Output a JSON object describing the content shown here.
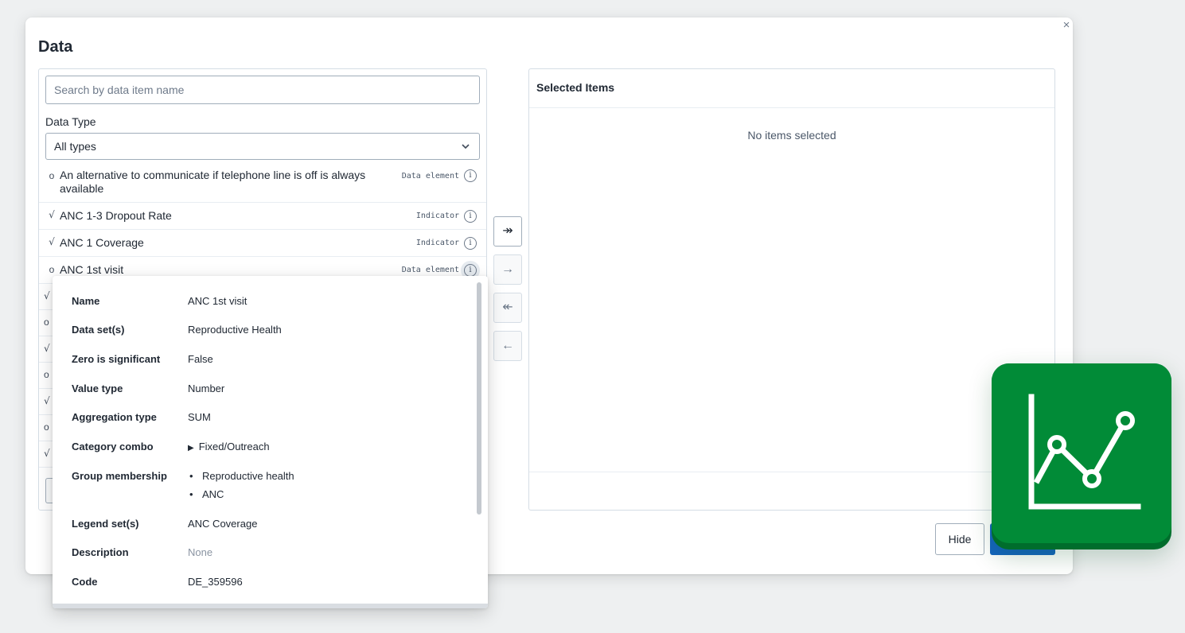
{
  "modal": {
    "title": "Data",
    "close_label": "×"
  },
  "search": {
    "placeholder": "Search by data item name",
    "value": ""
  },
  "data_type": {
    "label": "Data Type",
    "selected": "All types"
  },
  "items": [
    {
      "icon": "data-element-circle-icon",
      "name": "An alternative to communicate if telephone line is off is always available",
      "type": "Data element"
    },
    {
      "icon": "indicator-sqrt-icon",
      "name": "ANC 1-3 Dropout Rate",
      "type": "Indicator"
    },
    {
      "icon": "indicator-sqrt-icon",
      "name": "ANC 1 Coverage",
      "type": "Indicator"
    },
    {
      "icon": "data-element-circle-icon",
      "name": "ANC 1st visit",
      "type": "Data element"
    }
  ],
  "transfer": {
    "select_all_glyph": "↠",
    "select_glyph": "→",
    "deselect_all_glyph": "↞",
    "deselect_glyph": "←"
  },
  "selected_panel": {
    "title": "Selected Items",
    "empty_text": "No items selected"
  },
  "footer": {
    "hide_label": "Hide"
  },
  "popover": {
    "fields": {
      "name": {
        "label": "Name",
        "value": "ANC 1st visit"
      },
      "data_sets": {
        "label": "Data set(s)",
        "value": "Reproductive Health"
      },
      "zero_significant": {
        "label": "Zero is significant",
        "value": "False"
      },
      "value_type": {
        "label": "Value type",
        "value": "Number"
      },
      "aggregation_type": {
        "label": "Aggregation type",
        "value": "SUM"
      },
      "category_combo": {
        "label": "Category combo",
        "value": "Fixed/Outreach",
        "toggle_glyph": "▶"
      },
      "group_membership": {
        "label": "Group membership",
        "values": [
          "Reproductive health",
          "ANC"
        ]
      },
      "legend_sets": {
        "label": "Legend set(s)",
        "value": "ANC Coverage"
      },
      "description": {
        "label": "Description",
        "value": "None"
      },
      "code": {
        "label": "Code",
        "value": "DE_359596"
      }
    }
  },
  "glyphs": {
    "circle": "o",
    "sqrt": "√",
    "info": "i",
    "chevron": "⌄"
  },
  "colors": {
    "primary": "#1565c0",
    "app_icon_green": "#018b37",
    "app_icon_shadow": "#006d2c"
  }
}
